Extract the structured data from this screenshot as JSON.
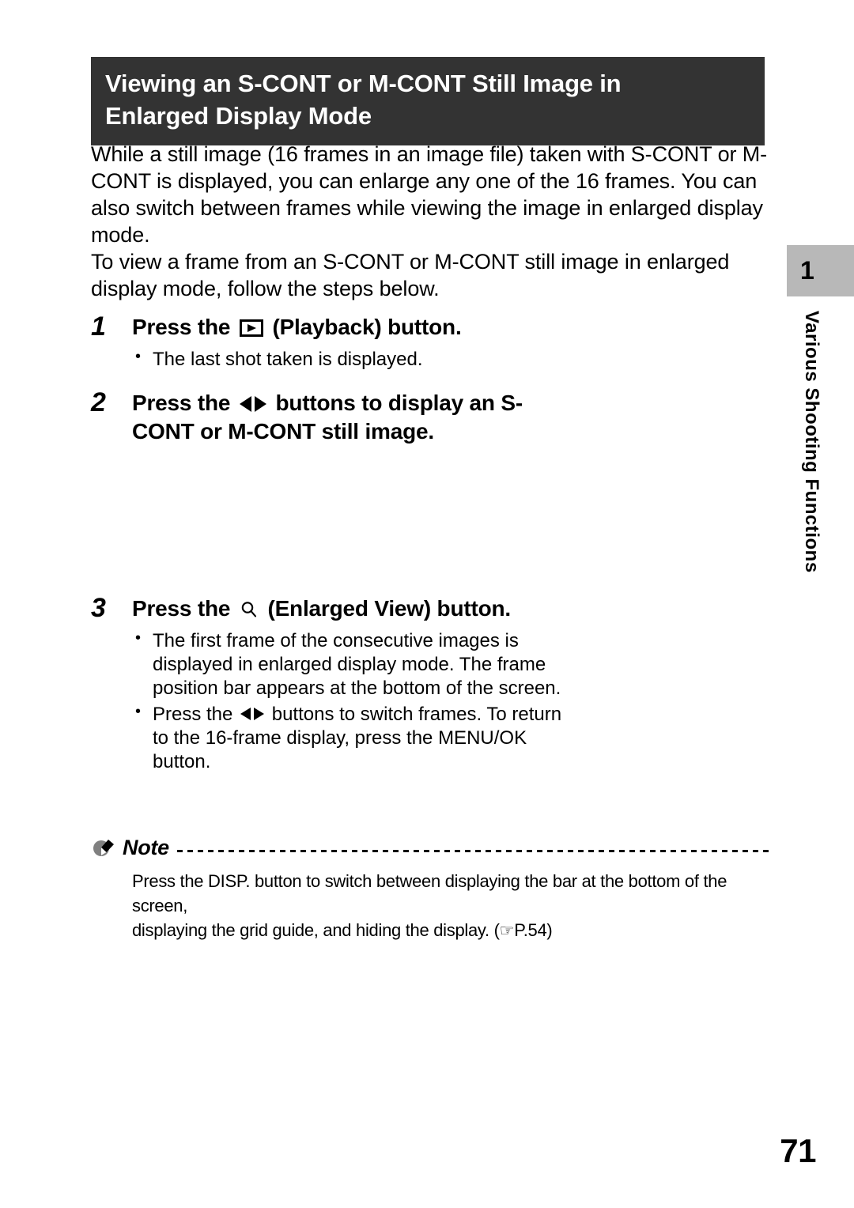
{
  "header": {
    "title_line1": "Viewing an S-CONT or M-CONT Still Image in",
    "title_line2": "Enlarged Display Mode",
    "background_color": "#333333",
    "text_color": "#ffffff"
  },
  "intro": {
    "paragraph1": "While a still image (16 frames in an image file) taken with S-CONT or M-CONT is displayed, you can enlarge any one of the 16 frames. You can also switch between frames while viewing the image in enlarged display mode.",
    "paragraph2": "To view a frame from an S-CONT or M-CONT still image in enlarged display mode, follow the steps below."
  },
  "steps": [
    {
      "number": "1",
      "title_before_icon": "Press the ",
      "icon": "playback-icon",
      "title_after_icon": " (Playback) button.",
      "bullets": [
        {
          "text": "The last shot taken is displayed."
        }
      ]
    },
    {
      "number": "2",
      "title_before_icon": "Press the ",
      "icon": "left-right-arrows-icon",
      "title_after_icon": " buttons to display an S-CONT or M-CONT still image.",
      "bullets": []
    },
    {
      "number": "3",
      "title_before_icon": "Press the ",
      "icon": "magnifier-icon",
      "title_after_icon": " (Enlarged View) button.",
      "bullets": [
        {
          "text": "The first frame of the consecutive images is displayed in enlarged display mode. The frame position bar appears at the bottom of the screen."
        },
        {
          "text_before_icon": "Press the ",
          "icon": "left-right-arrows-icon",
          "text_after_icon": " buttons to switch frames. To return to the 16-frame display, press the MENU/OK button."
        }
      ]
    }
  ],
  "note": {
    "icon": "note-pen-icon",
    "label": "Note",
    "line1": "Press the DISP. button to switch between displaying the bar at the bottom of the screen,",
    "line2_before_ref": "displaying the grid guide, and hiding the display. (",
    "reference_icon": "pointing-hand-icon",
    "reference": "P.54",
    "line2_after_ref": ")"
  },
  "side_tab": {
    "chapter_number": "1",
    "chapter_title": "Various Shooting Functions",
    "box_color": "#b8b8b8"
  },
  "footer": {
    "page_number": "71"
  }
}
